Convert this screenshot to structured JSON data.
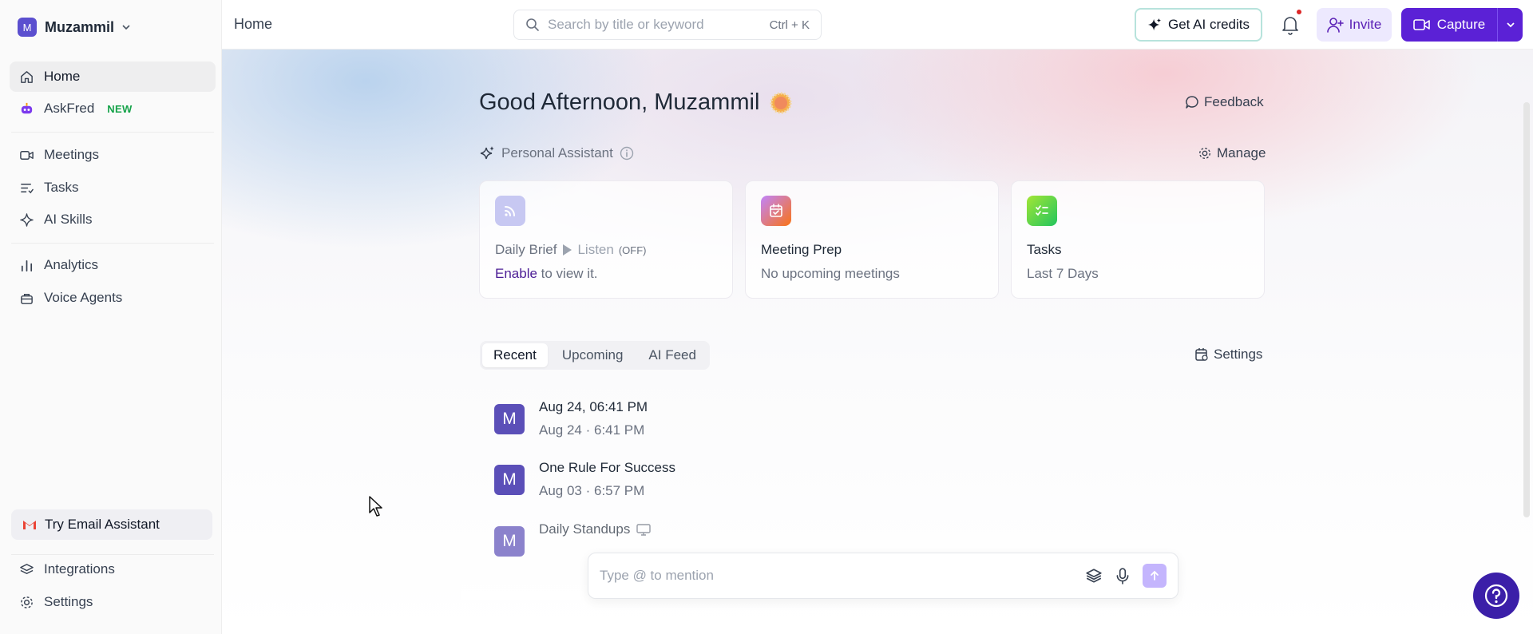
{
  "workspace": {
    "avatar_letter": "M",
    "name": "Muzammil"
  },
  "sidebar": {
    "items": [
      {
        "label": "Home",
        "icon": "home-icon"
      },
      {
        "label": "AskFred",
        "icon": "askfred-robot-icon",
        "badge": "NEW"
      },
      {
        "label": "Meetings",
        "icon": "video-icon"
      },
      {
        "label": "Tasks",
        "icon": "tasks-icon"
      },
      {
        "label": "AI Skills",
        "icon": "sparkle-icon"
      },
      {
        "label": "Analytics",
        "icon": "bar-chart-icon"
      },
      {
        "label": "Voice Agents",
        "icon": "briefcase-icon"
      }
    ],
    "email_assistant": "Try Email Assistant",
    "bottom": [
      {
        "label": "Integrations",
        "icon": "layers-icon"
      },
      {
        "label": "Settings",
        "icon": "gear-icon"
      }
    ]
  },
  "topbar": {
    "breadcrumb": "Home",
    "search_placeholder": "Search by title or keyword",
    "search_shortcut": "Ctrl + K",
    "ai_credits": "Get AI credits",
    "invite": "Invite",
    "capture": "Capture"
  },
  "main": {
    "greeting": "Good Afternoon, Muzammil",
    "feedback": "Feedback",
    "assistant_label": "Personal Assistant",
    "manage": "Manage",
    "cards": [
      {
        "title": "Daily Brief",
        "listen": "Listen",
        "status": "(OFF)",
        "link": "Enable",
        "subtitle": " to view it."
      },
      {
        "title": "Meeting Prep",
        "subtitle": "No upcoming meetings"
      },
      {
        "title": "Tasks",
        "subtitle": "Last 7 Days"
      }
    ],
    "tabs": [
      "Recent",
      "Upcoming",
      "AI Feed"
    ],
    "settings": "Settings",
    "meetings": [
      {
        "avatar": "M",
        "title": "Aug 24, 06:41 PM",
        "date": "Aug 24",
        "time": "6:41 PM"
      },
      {
        "avatar": "M",
        "title": "One Rule For Success",
        "date": "Aug 03",
        "time": "6:57 PM"
      },
      {
        "avatar": "M",
        "title": "Daily Standups",
        "date": "",
        "time": ""
      }
    ],
    "chat_placeholder": "Type @ to mention"
  },
  "colors": {
    "brand": "#5b21d6",
    "accent_light": "#ede9fe",
    "avatar": "#5b4fb8",
    "notification": "#dc2626"
  }
}
